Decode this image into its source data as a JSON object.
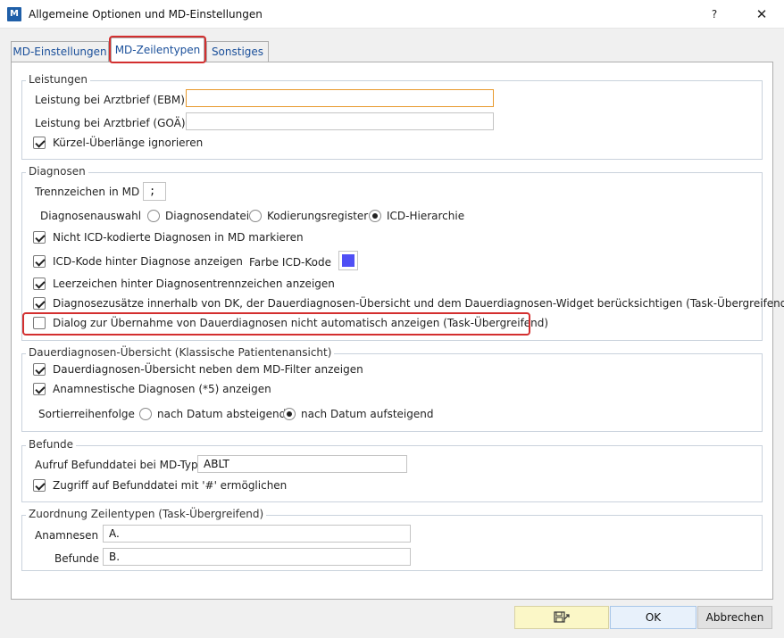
{
  "window": {
    "title": "Allgemeine Optionen und MD-Einstellungen",
    "app_icon_text": "M",
    "help_label": "?",
    "close_label": "✕"
  },
  "tabs": [
    {
      "label": "MD-Einstellungen",
      "active": false
    },
    {
      "label": "MD-Zeilentypen",
      "active": true
    },
    {
      "label": "Sonstiges",
      "active": false
    }
  ],
  "leistungen": {
    "title": "Leistungen",
    "ebm_label": "Leistung bei Arztbrief (EBM)",
    "ebm_value": "",
    "goae_label": "Leistung bei Arztbrief (GOÄ)",
    "goae_value": "",
    "kuerzel_label": "Kürzel-Überlänge ignorieren",
    "kuerzel_checked": true
  },
  "diagnosen": {
    "title": "Diagnosen",
    "trenn_label": "Trennzeichen in MD",
    "trenn_value": ";",
    "auswahl_label": "Diagnosenauswahl",
    "auswahl_options": [
      "Diagnosendatei",
      "Kodierungsregister",
      "ICD-Hierarchie"
    ],
    "auswahl_selected": "ICD-Hierarchie",
    "nicht_icd_label": "Nicht ICD-kodierte Diagnosen in MD markieren",
    "icd_kode_label": "ICD-Kode hinter Diagnose anzeigen",
    "farbe_label": "Farbe ICD-Kode",
    "farbe_color": "#4f4ff5",
    "leerzeichen_label": "Leerzeichen hinter Diagnosentrennzeichen anzeigen",
    "zusaetze_label": "Diagnosezusätze innerhalb von DK, der Dauerdiagnosen-Übersicht und dem Dauerdiagnosen-Widget berücksichtigen (Task-Übergreifend)",
    "dialog_label": "Dialog zur Übernahme von Dauerdiagnosen nicht automatisch anzeigen (Task-Übergreifend)",
    "dialog_checked": false
  },
  "dauer": {
    "title": "Dauerdiagnosen-Übersicht (Klassische Patientenansicht)",
    "neben_label": "Dauerdiagnosen-Übersicht neben dem MD-Filter anzeigen",
    "anamn_label": "Anamnestische Diagnosen (*5) anzeigen",
    "sort_label": "Sortierreihenfolge",
    "sort_options": [
      "nach Datum absteigend",
      "nach Datum aufsteigend"
    ],
    "sort_selected": "nach Datum aufsteigend"
  },
  "befunde": {
    "title": "Befunde",
    "aufruf_label": "Aufruf Befunddatei bei MD-Typ",
    "aufruf_value": "ABLT",
    "zugriff_label": "Zugriff auf Befunddatei mit '#' ermöglichen"
  },
  "zuordnung": {
    "title": "Zuordnung Zeilentypen (Task-Übergreifend)",
    "anamnesen_label": "Anamnesen",
    "anamnesen_value": "A.",
    "befunde_label": "Befunde",
    "befunde_value": "B."
  },
  "buttons": {
    "save_icon": "save-layout-icon",
    "ok": "OK",
    "cancel": "Abbrechen"
  },
  "colors": {
    "highlight": "#d32f2f",
    "tab_text": "#1a4f9a",
    "focus_border": "#e89a2e"
  }
}
